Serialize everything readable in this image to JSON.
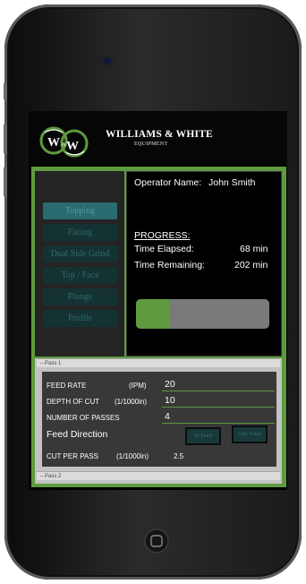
{
  "app": {
    "brand_title": "WILLIAMS & WHITE",
    "brand_subtitle": "EQUIPMENT",
    "logo_text": "W&W",
    "accent_color": "#5e9a40"
  },
  "modes": [
    {
      "label": "Topping",
      "active": true
    },
    {
      "label": "Facing",
      "active": false
    },
    {
      "label": "Dual Side Grind",
      "active": false
    },
    {
      "label": "Top / Face",
      "active": false
    },
    {
      "label": "Plunge",
      "active": false
    },
    {
      "label": "Profile",
      "active": false
    }
  ],
  "status": {
    "operator_label": "Operator Name:",
    "operator_name": "John Smith",
    "progress_heading": "PROGRESS:",
    "elapsed_label": "Time Elapsed:",
    "elapsed_value": "68 min",
    "remaining_label": "Time Remaining:",
    "remaining_value": "202 min",
    "progress_fraction": 0.25
  },
  "passes": {
    "pass1_label": "Pass 1",
    "pass2_label": "Pass 2"
  },
  "params": {
    "feed_rate_label": "FEED RATE",
    "feed_rate_unit": "(IPM)",
    "feed_rate_value": "20",
    "depth_label": "DEPTH OF CUT",
    "depth_unit": "(1/1000in)",
    "depth_value": "10",
    "passes_label": "NUMBER OF PASSES",
    "passes_value": "4",
    "direction_label": "Feed Direction",
    "in_feed": "In Feed",
    "out_feed": "Out Feed",
    "cut_label": "CUT PER PASS",
    "cut_unit": "(1/1000in)",
    "cut_value": "2.5"
  }
}
